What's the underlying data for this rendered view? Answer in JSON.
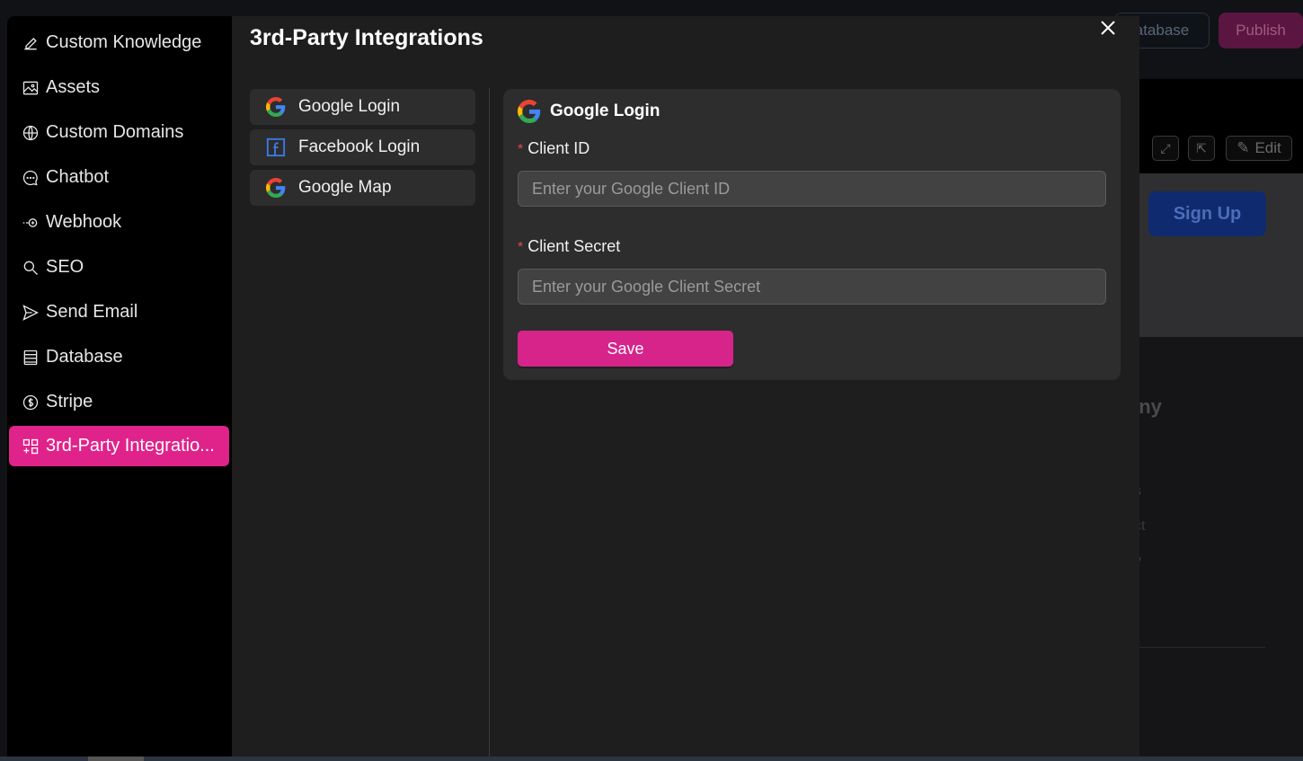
{
  "background": {
    "database_label": "atabase",
    "publish_label": "Publish",
    "edit_label": "Edit",
    "signup_label": "Sign Up",
    "footer_title": "any",
    "footer_links": [
      "s",
      "ct",
      "y"
    ]
  },
  "sidebar": {
    "items": [
      {
        "label": "Custom Knowledge",
        "icon": "pencil-icon"
      },
      {
        "label": "Assets",
        "icon": "image-icon"
      },
      {
        "label": "Custom Domains",
        "icon": "globe-icon"
      },
      {
        "label": "Chatbot",
        "icon": "chat-icon"
      },
      {
        "label": "Webhook",
        "icon": "webhook-icon"
      },
      {
        "label": "SEO",
        "icon": "search-icon"
      },
      {
        "label": "Send Email",
        "icon": "send-icon"
      },
      {
        "label": "Database",
        "icon": "database-icon"
      },
      {
        "label": "Stripe",
        "icon": "dollar-icon"
      },
      {
        "label": "3rd-Party Integratio...",
        "icon": "grid-plus-icon",
        "active": true
      }
    ]
  },
  "modal": {
    "title": "3rd-Party Integrations"
  },
  "integrations": {
    "items": [
      {
        "label": "Google Login",
        "icon": "google-icon"
      },
      {
        "label": "Facebook Login",
        "icon": "facebook-icon"
      },
      {
        "label": "Google Map",
        "icon": "google-icon"
      }
    ]
  },
  "form": {
    "title": "Google Login",
    "client_id_label": "Client ID",
    "client_id_placeholder": "Enter your Google Client ID",
    "client_id_value": "",
    "client_secret_label": "Client Secret",
    "client_secret_placeholder": "Enter your Google Client Secret",
    "client_secret_value": "",
    "required_marker": "*",
    "save_label": "Save"
  },
  "colors": {
    "accent": "#e0238a",
    "save_button": "#d6248a",
    "required": "#e0455a"
  }
}
